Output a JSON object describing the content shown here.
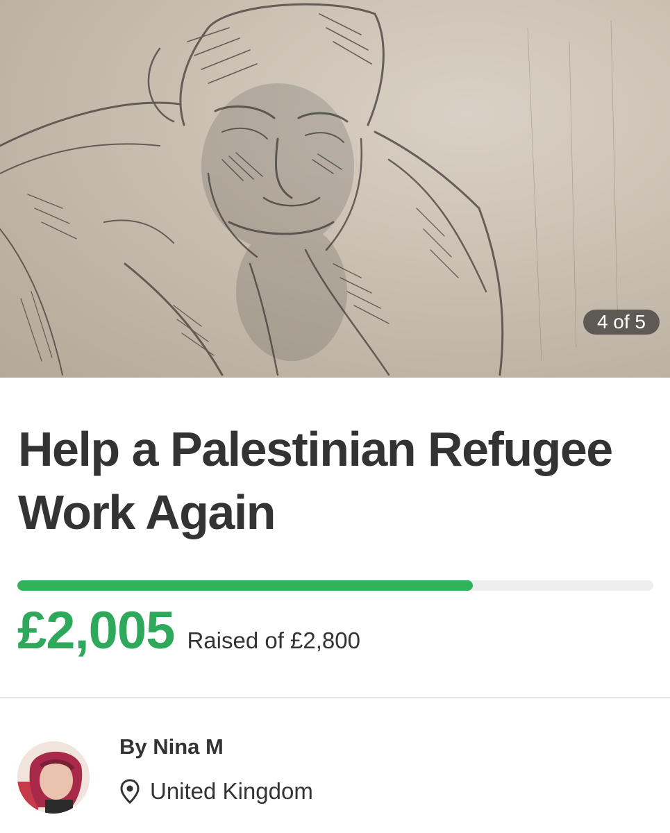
{
  "gallery": {
    "counter_label": "4 of 5",
    "current_index": 4,
    "total_images": 5
  },
  "campaign": {
    "title": "Help a Palestinian Refugee Work Again",
    "amount_raised": "£2,005",
    "goal_label": "Raised of £2,800",
    "progress_fraction": 0.716
  },
  "organizer": {
    "name_label": "By Nina M",
    "location": "United Kingdom",
    "location_icon": "map-pin-icon"
  },
  "colors": {
    "accent_green": "#2ea85a",
    "progress_track": "#eeeeee"
  }
}
